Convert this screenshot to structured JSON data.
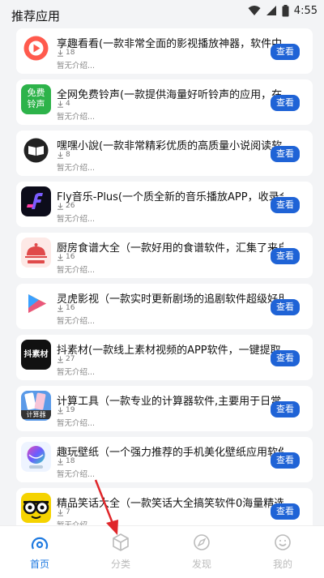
{
  "status": {
    "time": "4:55"
  },
  "header": {
    "title": "推荐应用"
  },
  "apps": [
    {
      "name": "享趣看看(一款非常全面的影视播放神器，软件中",
      "downloads": "18",
      "intro": "暂无介绍...",
      "button": "查看",
      "icon": "play-circle-icon",
      "color": "#ff5a4d"
    },
    {
      "name": "全网免费铃声(一款提供海量好听铃声的应用，在",
      "downloads": "4",
      "intro": "暂无介绍...",
      "button": "查看",
      "icon": "ringtone-text-icon",
      "color": "#2db34a",
      "icon_text": [
        "免费",
        "铃声"
      ]
    },
    {
      "name": "嘿嘿小說(一款非常精彩优质的高质量小说阅读软",
      "downloads": "8",
      "intro": "暂无介绍...",
      "button": "查看",
      "icon": "book-icon",
      "color": "#222"
    },
    {
      "name": "Fly音乐-Plus(一个质全新的音乐播放APP，收录全",
      "downloads": "26",
      "intro": "暂无介绍...",
      "button": "查看",
      "icon": "music-f-icon",
      "color": "#3a2ad8"
    },
    {
      "name": "厨房食谱大全（一款好用的食谱软件，汇集了来自",
      "downloads": "16",
      "intro": "暂无介绍...",
      "button": "查看",
      "icon": "cloche-icon",
      "color": "#e04a4a"
    },
    {
      "name": "灵虎影视（一款实时更新剧场的追剧软件超级好用",
      "downloads": "16",
      "intro": "暂无介绍...",
      "button": "查看",
      "icon": "colorful-play-icon",
      "color": "#f0a030"
    },
    {
      "name": "抖素材(一款线上素材视频的APP软件，一键提取",
      "downloads": "27",
      "intro": "暂无介绍...",
      "button": "查看",
      "icon": "material-text-icon",
      "color": "#111",
      "icon_text": [
        "抖素材"
      ]
    },
    {
      "name": "计算工具（一款专业的计算器软件,主要用于日常",
      "downloads": "19",
      "intro": "暂无介绍...",
      "button": "查看",
      "icon": "calculator-icon",
      "color": "#5a9ae8",
      "icon_text": [
        "计算器"
      ]
    },
    {
      "name": "趣玩壁纸（一个强力推荐的手机美化壁纸应用软件",
      "downloads": "18",
      "intro": "暂无介绍...",
      "button": "查看",
      "icon": "wallpaper-icon",
      "color": "#3ad0c0"
    },
    {
      "name": "精品笑话大全（一款笑话大全搞笑软件0海量精选",
      "downloads": "7",
      "intro": "暂无介绍...",
      "button": "查看",
      "icon": "glasses-face-icon",
      "color": "#f5d300"
    }
  ],
  "tabs": [
    {
      "label": "首页",
      "icon": "home-icon",
      "active": true
    },
    {
      "label": "分类",
      "icon": "cube-icon",
      "active": false
    },
    {
      "label": "发现",
      "icon": "compass-icon",
      "active": false
    },
    {
      "label": "我的",
      "icon": "smile-icon",
      "active": false
    }
  ],
  "colors": {
    "accent": "#1f63d6",
    "tab_active": "#1f7ae0",
    "arrow": "#e0262a"
  }
}
